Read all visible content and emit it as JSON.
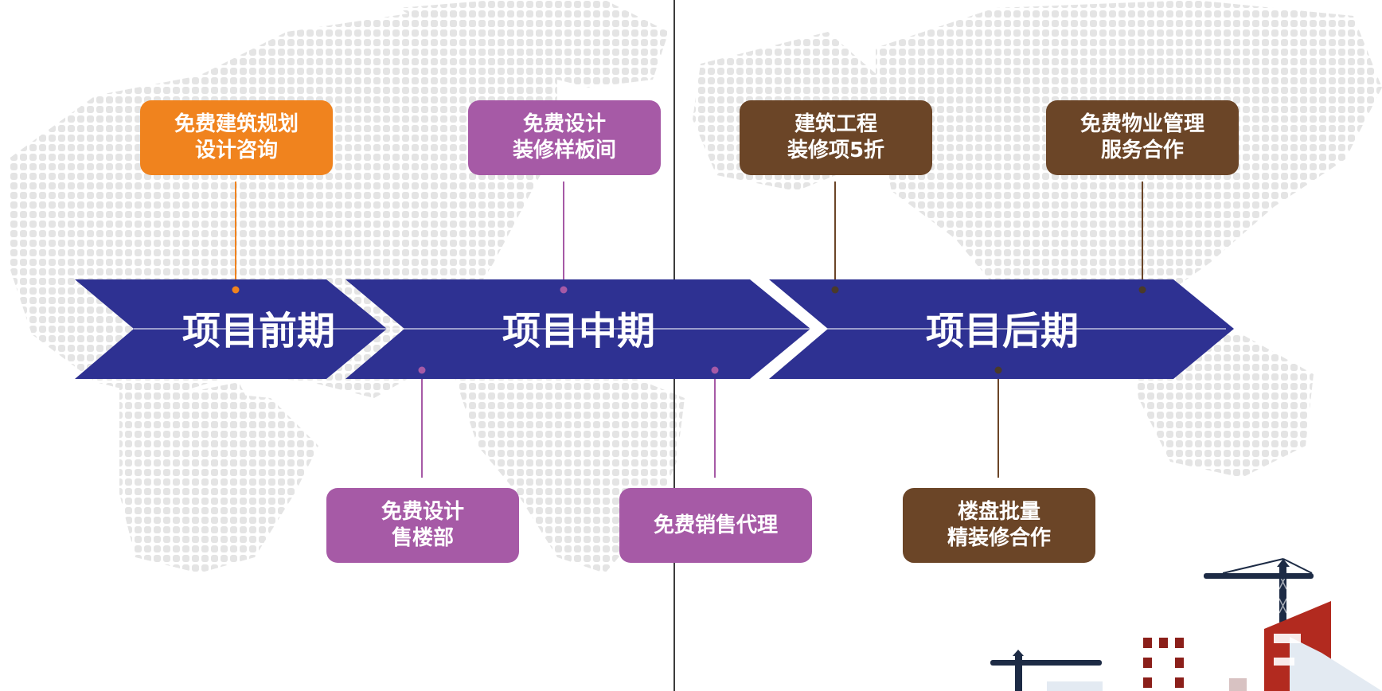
{
  "colors": {
    "arrow": "#2e3192",
    "orange": "#f0831e",
    "purple": "#a65aa6",
    "brown": "#6b4527",
    "dots": "#e4e4e4",
    "crane": "#1d2b45",
    "building_red": "#b22a1f"
  },
  "phases": {
    "early": "项目前期",
    "middle": "项目中期",
    "late": "项目后期"
  },
  "boxes": {
    "planning": [
      "免费建筑规划",
      "设计咨询"
    ],
    "showroom": [
      "免费设计",
      "装修样板间"
    ],
    "discount": [
      "建筑工程",
      "装修项5折"
    ],
    "property": [
      "免费物业管理",
      "服务合作"
    ],
    "sales_office": [
      "免费设计",
      "售楼部"
    ],
    "agency": [
      "免费销售代理"
    ],
    "bulk": [
      "楼盘批量",
      "精装修合作"
    ]
  },
  "icons": {
    "map": "world-map-dots",
    "decoration": "construction-crane-building-illustration"
  }
}
